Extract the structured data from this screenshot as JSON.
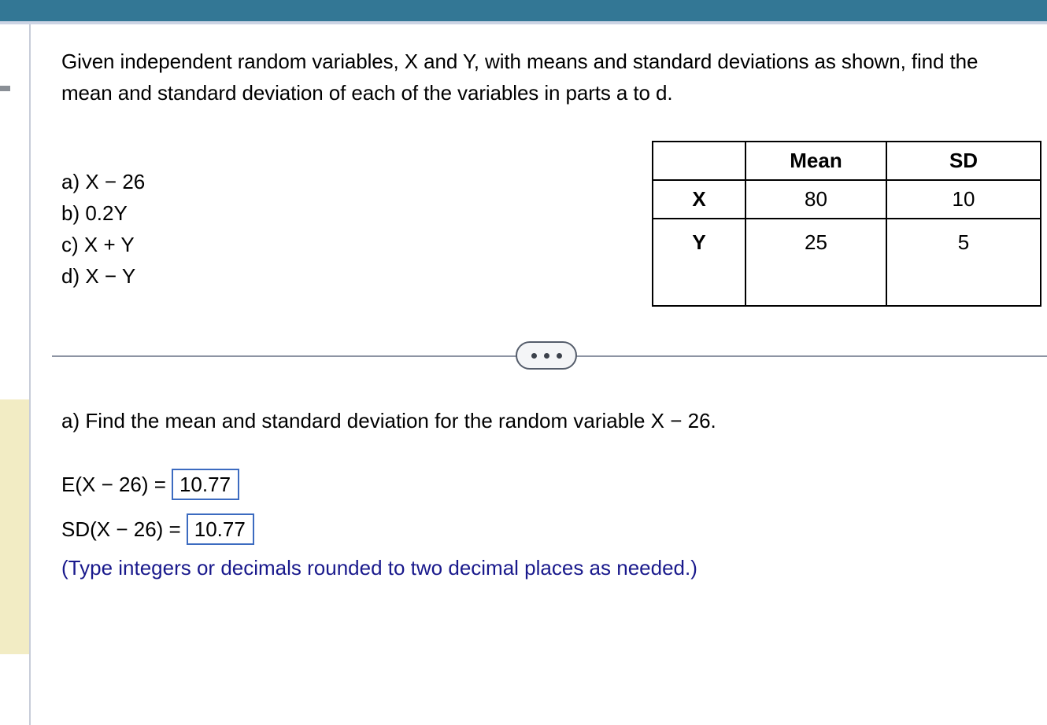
{
  "header": {
    "bar_color": "#337795",
    "underline_color": "#ccd4e4"
  },
  "gutter": {
    "highlight_color": "#f2ecc4",
    "divider_color": "#c8cdd9",
    "dash_color": "#8a8f96"
  },
  "problem": {
    "statement": "Given independent random variables, X and Y, with means and standard deviations as shown, find the mean and standard deviation of each of the variables in parts a to d.",
    "parts": [
      {
        "label": "a) X − 26"
      },
      {
        "label": "b) 0.2Y"
      },
      {
        "label": "c) X + Y"
      },
      {
        "label": "d) X − Y"
      }
    ]
  },
  "stats_table": {
    "headers": [
      "",
      "Mean",
      "SD"
    ],
    "rows": [
      {
        "variable": "X",
        "mean": "80",
        "sd": "10"
      },
      {
        "variable": "Y",
        "mean": "25",
        "sd": "5"
      }
    ]
  },
  "divider": {
    "dots": [
      "•",
      "•",
      "•"
    ]
  },
  "answer_section": {
    "prompt": "a) Find the mean and standard deviation for the random variable X − 26.",
    "fields": [
      {
        "label": "E(X − 26) =",
        "value": "10.77",
        "placeholder": ""
      },
      {
        "label": "SD(X − 26) =",
        "value": "10.77",
        "placeholder": ""
      }
    ],
    "note": "(Type integers or decimals rounded to two decimal places as needed.)",
    "note_color": "#19198c",
    "box_border_color": "#3c6bc0"
  }
}
